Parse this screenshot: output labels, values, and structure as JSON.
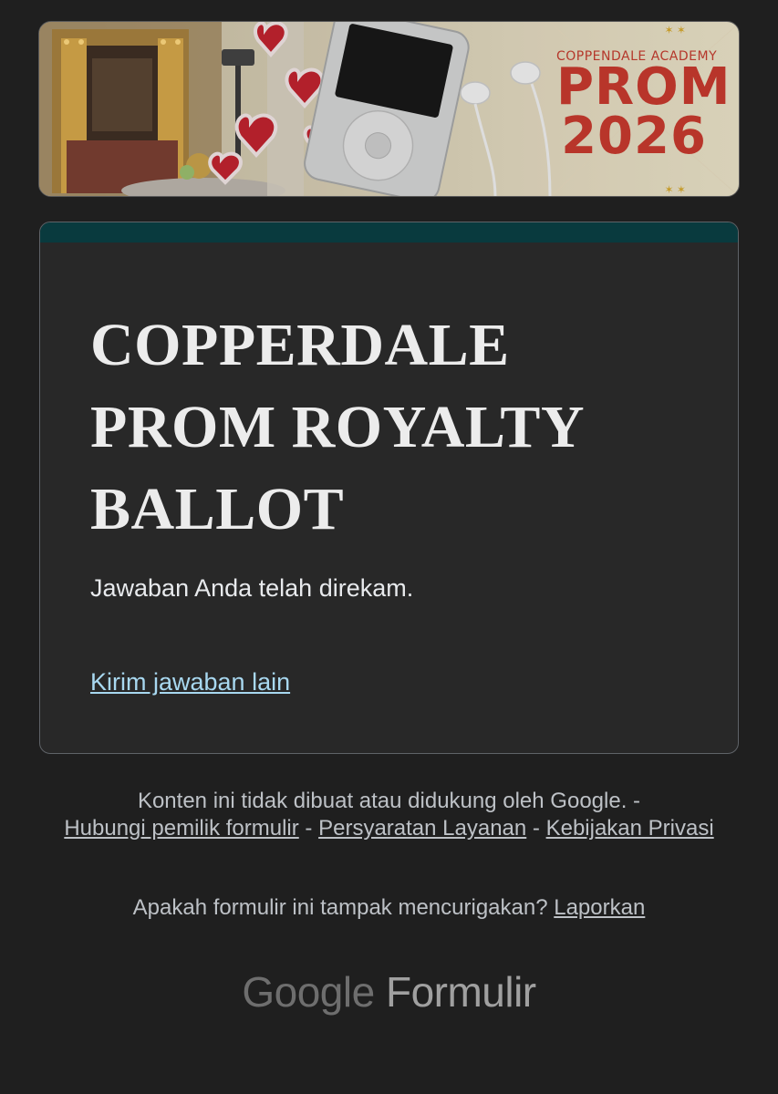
{
  "banner": {
    "academy": "COPPENDALE ACADEMY",
    "prom": "PROM",
    "year": "2026"
  },
  "form": {
    "title": "COPPERDALE PROM ROYALTY BALLOT",
    "message": "Jawaban Anda telah direkam.",
    "another_response_link": "Kirim jawaban lain",
    "accent_color": "#093a3e"
  },
  "footer": {
    "disclaimer": "Konten ini tidak dibuat atau didukung oleh Google.",
    "sep": "-",
    "contact_owner": "Hubungi pemilik formulir",
    "terms": "Persyaratan Layanan",
    "privacy": "Kebijakan Privasi",
    "suspicious": "Apakah formulir ini tampak mencurigakan?",
    "report": "Laporkan"
  },
  "brand": {
    "google": "Google",
    "forms": "Formulir"
  }
}
